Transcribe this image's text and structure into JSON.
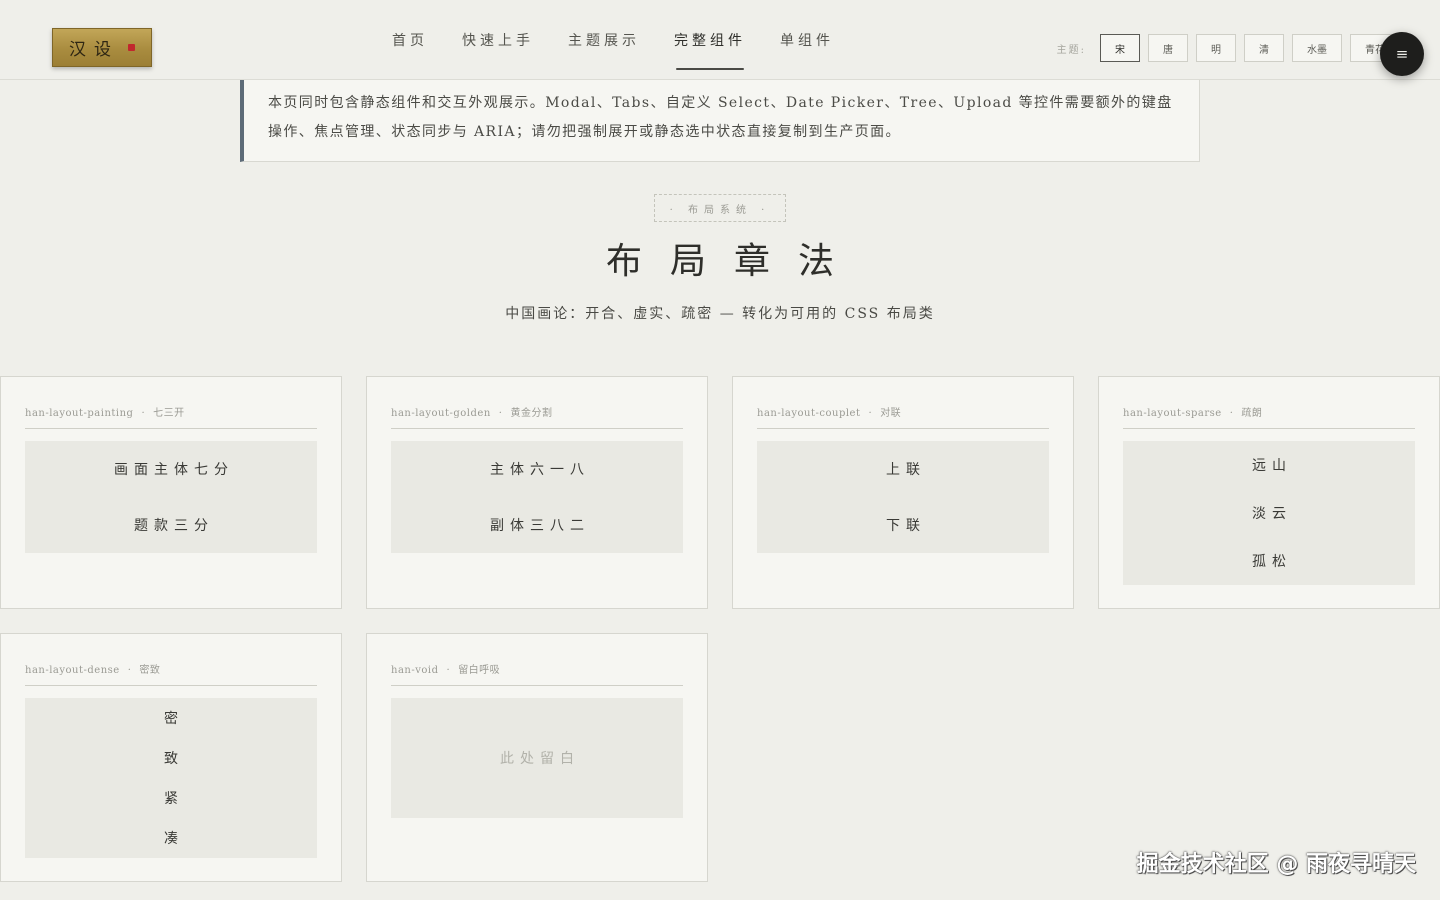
{
  "header": {
    "logo_text": "汉设",
    "nav": [
      {
        "label": "首页",
        "active": false
      },
      {
        "label": "快速上手",
        "active": false
      },
      {
        "label": "主题展示",
        "active": false
      },
      {
        "label": "完整组件",
        "active": true
      },
      {
        "label": "单组件",
        "active": false
      }
    ],
    "theme_label": "主题:",
    "themes": [
      {
        "label": "宋",
        "active": true
      },
      {
        "label": "唐",
        "active": false
      },
      {
        "label": "明",
        "active": false
      },
      {
        "label": "清",
        "active": false
      },
      {
        "label": "水墨",
        "active": false
      },
      {
        "label": "青花",
        "active": false
      }
    ],
    "menu_icon": "≡"
  },
  "notice": {
    "text": "本页同时包含静态组件和交互外观展示。Modal、Tabs、自定义 Select、Date Picker、Tree、Upload 等控件需要额外的键盘操作、焦点管理、状态同步与 ARIA；请勿把强制展开或静态选中状态直接复制到生产页面。"
  },
  "section": {
    "tag": "· 布局系统 ·",
    "title": "布局章法",
    "subtitle": "中国画论：开合、虚实、疏密 — 转化为可用的 CSS 布局类"
  },
  "cards": [
    {
      "class_name": "han-layout-painting",
      "desc": "七三开",
      "lines": [
        "画面主体七分",
        "题款三分"
      ]
    },
    {
      "class_name": "han-layout-golden",
      "desc": "黄金分割",
      "lines": [
        "主体六一八",
        "副体三八二"
      ]
    },
    {
      "class_name": "han-layout-couplet",
      "desc": "对联",
      "lines": [
        "上联",
        "下联"
      ]
    },
    {
      "class_name": "han-layout-sparse",
      "desc": "疏朗",
      "lines": [
        "远山",
        "淡云",
        "孤松"
      ]
    },
    {
      "class_name": "han-layout-dense",
      "desc": "密致",
      "lines": [
        "密",
        "致",
        "紧",
        "凑"
      ]
    },
    {
      "class_name": "han-void",
      "desc": "留白呼吸",
      "lines": [
        "此处留白"
      ]
    }
  ],
  "watermark": "掘金技术社区 @ 雨夜寻晴天",
  "colors": {
    "background": "#efefea",
    "card": "#f6f6f2",
    "gold": "#b09042",
    "seal_red": "#c1272d",
    "notice_accent": "#5d6b78"
  }
}
